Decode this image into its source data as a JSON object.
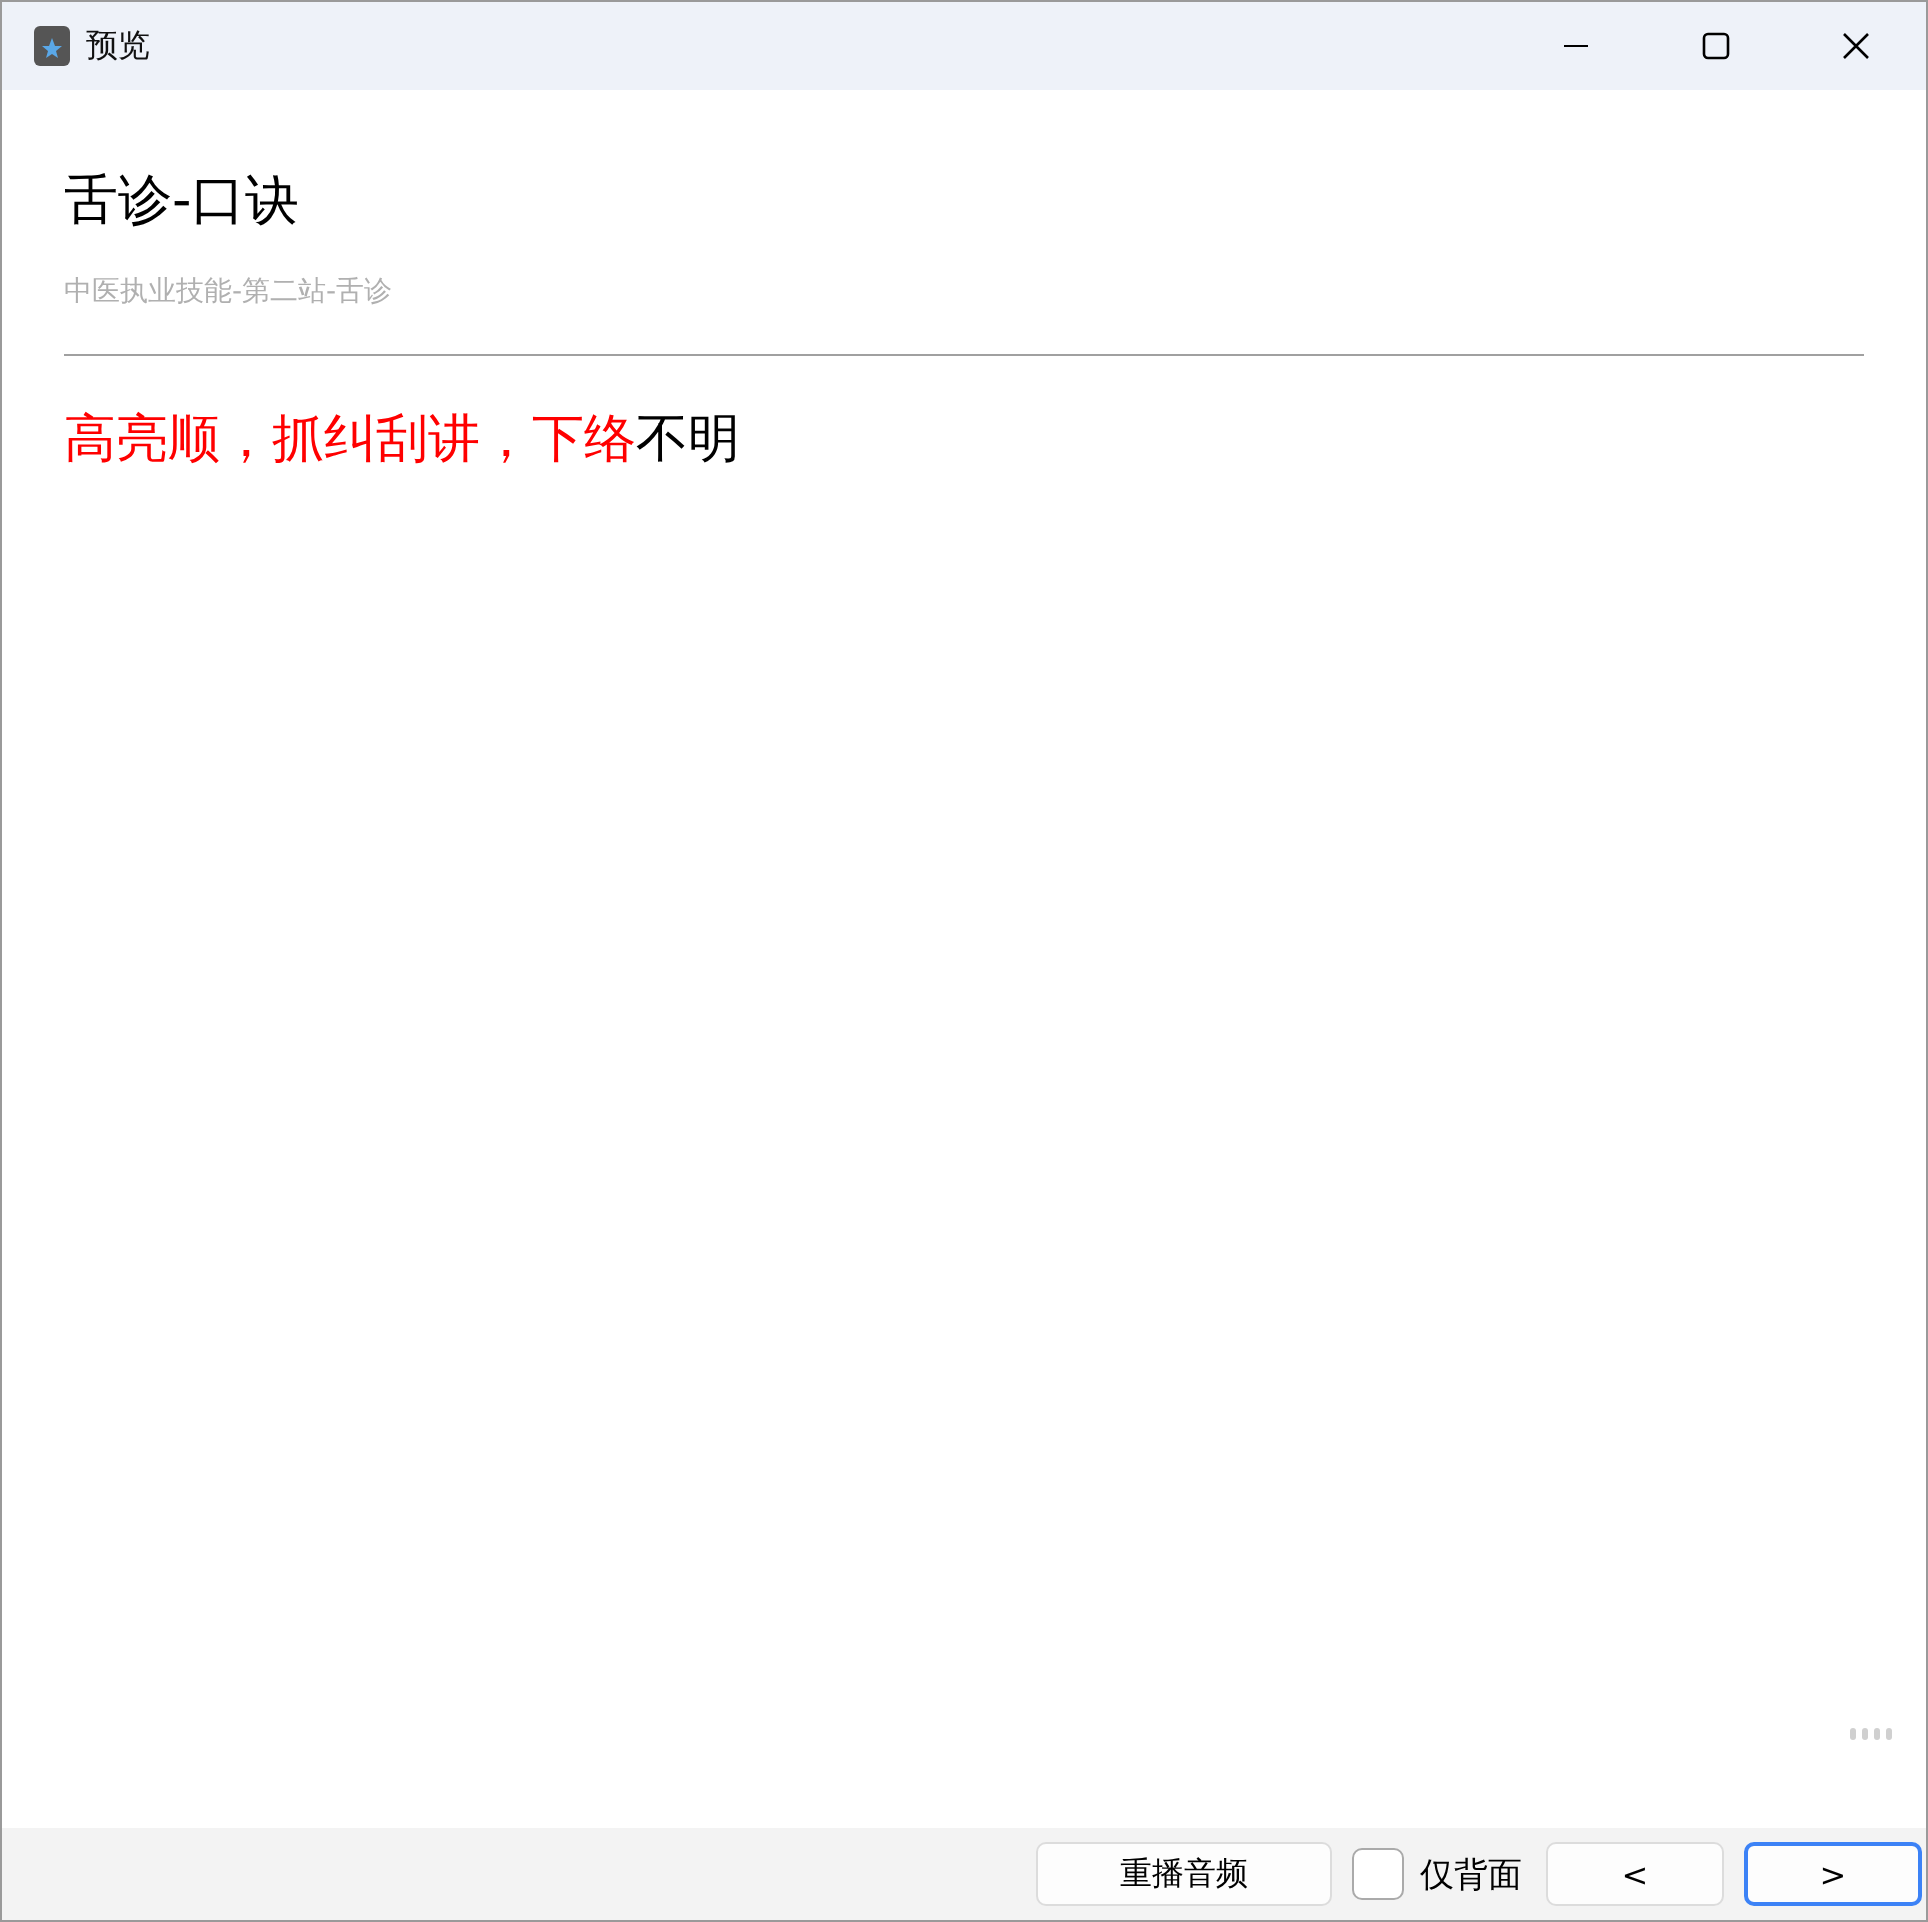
{
  "window": {
    "title": "预览"
  },
  "card": {
    "title": "舌诊-口诀",
    "subtitle": "中医执业技能-第二站-舌诊",
    "segments": [
      {
        "text": "高亮顺，抓纠刮讲，下络",
        "highlighted": true
      },
      {
        "text": "不明",
        "highlighted": false
      }
    ]
  },
  "footer": {
    "replay_button": "重播音频",
    "back_only": {
      "label": "仅背面",
      "checked": false
    },
    "buttons": [
      {
        "label": "<",
        "focused": false
      },
      {
        "label": ">",
        "focused": true
      }
    ]
  }
}
